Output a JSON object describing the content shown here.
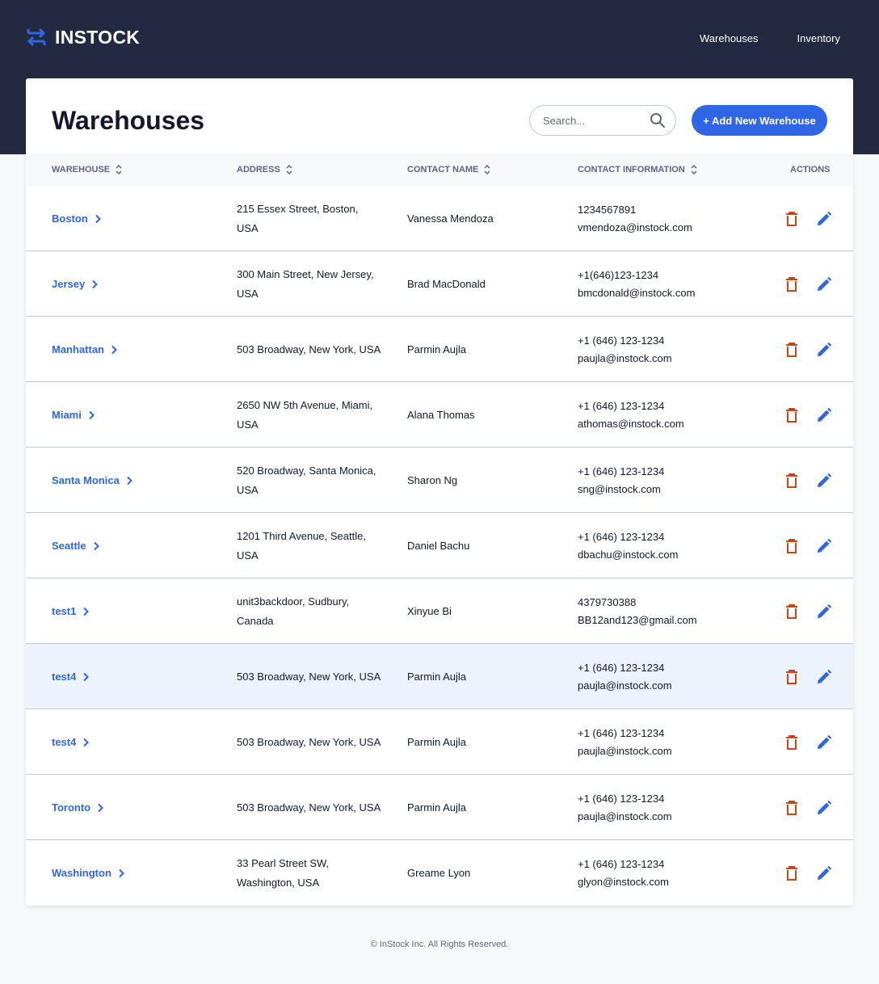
{
  "brand": {
    "name": "INSTOCK",
    "accent": "#2e66e5",
    "header_bg": "#232940",
    "delete_color": "#c94515"
  },
  "nav": {
    "warehouses": "Warehouses",
    "inventory": "Inventory"
  },
  "page": {
    "title": "Warehouses",
    "search_placeholder": "Search...",
    "add_button": "+ Add New Warehouse"
  },
  "table": {
    "columns": {
      "warehouse": "WAREHOUSE",
      "address": "ADDRESS",
      "contact_name": "CONTACT NAME",
      "contact_info": "CONTACT INFORMATION",
      "actions": "ACTIONS"
    },
    "rows": [
      {
        "name": "Boston",
        "address": "215 Essex Street, Boston, USA",
        "contact": "Vanessa Mendoza",
        "phone": "1234567891",
        "email": "vmendoza@instock.com"
      },
      {
        "name": "Jersey",
        "address": "300 Main Street, New Jersey, USA",
        "contact": "Brad MacDonald",
        "phone": "+1(646)123-1234",
        "email": "bmcdonald@instock.com"
      },
      {
        "name": "Manhattan",
        "address": "503 Broadway, New York, USA",
        "contact": "Parmin Aujla",
        "phone": "+1 (646) 123-1234",
        "email": "paujla@instock.com"
      },
      {
        "name": "Miami",
        "address": "2650 NW 5th Avenue, Miami, USA",
        "contact": "Alana Thomas",
        "phone": "+1 (646) 123-1234",
        "email": "athomas@instock.com"
      },
      {
        "name": "Santa Monica",
        "address": "520 Broadway, Santa Monica, USA",
        "contact": "Sharon Ng",
        "phone": "+1 (646) 123-1234",
        "email": "sng@instock.com"
      },
      {
        "name": "Seattle",
        "address": "1201 Third Avenue, Seattle, USA",
        "contact": "Daniel Bachu",
        "phone": "+1 (646) 123-1234",
        "email": "dbachu@instock.com"
      },
      {
        "name": "test1",
        "address": "unit3backdoor, Sudbury, Canada",
        "contact": "Xinyue Bi",
        "phone": "4379730388",
        "email": "BB12and123@gmail.com"
      },
      {
        "name": "test4",
        "address": "503 Broadway, New York, USA",
        "contact": "Parmin Aujla",
        "phone": "+1 (646) 123-1234",
        "email": "paujla@instock.com"
      },
      {
        "name": "test4",
        "address": "503 Broadway, New York, USA",
        "contact": "Parmin Aujla",
        "phone": "+1 (646) 123-1234",
        "email": "paujla@instock.com"
      },
      {
        "name": "Toronto",
        "address": "503 Broadway, New York, USA",
        "contact": "Parmin Aujla",
        "phone": "+1 (646) 123-1234",
        "email": "paujla@instock.com"
      },
      {
        "name": "Washington",
        "address": "33 Pearl Street SW, Washington, USA",
        "contact": "Greame Lyon",
        "phone": "+1 (646) 123-1234",
        "email": "glyon@instock.com"
      }
    ]
  },
  "icons": {
    "logo": "swap-arrows-icon",
    "search": "search-icon",
    "sort": "sort-icon",
    "chevron": "chevron-right-icon",
    "delete": "trash-icon",
    "edit": "pencil-icon"
  },
  "footer": {
    "text": "© InStock Inc. All Rights Reserved."
  }
}
